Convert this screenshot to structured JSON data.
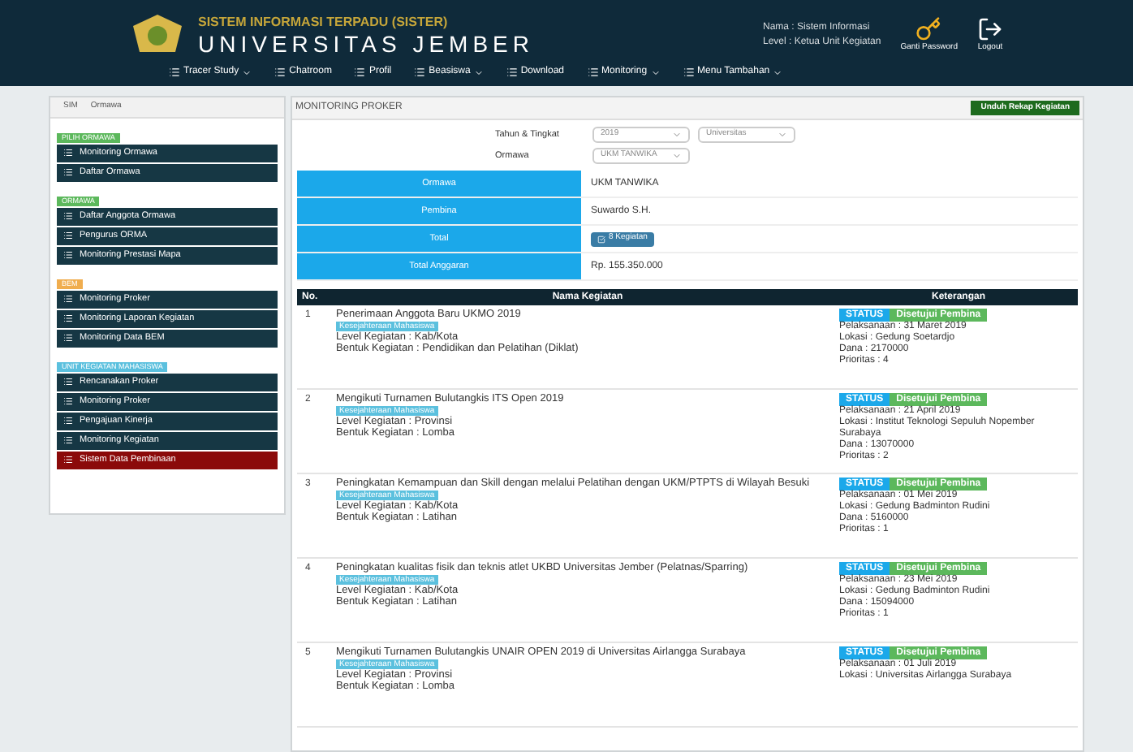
{
  "header": {
    "system": "SISTEM INFORMASI TERPADU (SISTER)",
    "university": "UNIVERSITAS JEMBER",
    "user_name": "Nama : Sistem Informasi",
    "user_level": "Level : Ketua Unit Kegiatan",
    "password_link": "Ganti Password",
    "logout_link": "Logout"
  },
  "nav": [
    {
      "label": "Tracer Study",
      "dropdown": true
    },
    {
      "label": "Chatroom",
      "dropdown": false
    },
    {
      "label": "Profil",
      "dropdown": false
    },
    {
      "label": "Beasiswa",
      "dropdown": true
    },
    {
      "label": "Download",
      "dropdown": false
    },
    {
      "label": "Monitoring",
      "dropdown": true
    },
    {
      "label": "Menu Tambahan",
      "dropdown": true
    }
  ],
  "breadcrumb": [
    "SIM",
    "Ormawa"
  ],
  "sidebar": [
    {
      "title": "PILIH ORMAWA",
      "color": "#5cb85c",
      "items": [
        {
          "label": "Monitoring Ormawa",
          "danger": false
        },
        {
          "label": "Daftar Ormawa",
          "danger": false
        }
      ]
    },
    {
      "title": "ORMAWA",
      "color": "#5cb85c",
      "items": [
        {
          "label": "Daftar Anggota Ormawa",
          "danger": false
        },
        {
          "label": "Pengurus ORMA",
          "danger": false
        },
        {
          "label": "Monitoring Prestasi Mapa",
          "danger": false
        }
      ]
    },
    {
      "title": "BEM",
      "color": "#f0ad4e",
      "items": [
        {
          "label": "Monitoring Proker",
          "danger": false
        },
        {
          "label": "Monitoring Laporan Kegiatan",
          "danger": false
        },
        {
          "label": "Monitoring Data BEM",
          "danger": false
        }
      ]
    },
    {
      "title": "UNIT KEGIATAN MAHASISWA",
      "color": "#5bc0de",
      "items": [
        {
          "label": "Rencanakan Proker",
          "danger": false
        },
        {
          "label": "Monitoring Proker",
          "danger": false
        },
        {
          "label": "Pengajuan Kinerja",
          "danger": false
        },
        {
          "label": "Monitoring Kegiatan",
          "danger": false
        },
        {
          "label": "Sistem Data Pembinaan",
          "danger": true
        }
      ]
    }
  ],
  "page_title": "MONITORING PROKER",
  "download_button": "Unduh Rekap Kegiatan",
  "filters": [
    {
      "label": "Tahun & Tingkat",
      "selects": [
        "2019",
        "Universitas"
      ]
    },
    {
      "label": "Ormawa",
      "selects": [
        "UKM TANWIKA"
      ]
    }
  ],
  "info": [
    {
      "label": "Ormawa",
      "kind": "text",
      "value": "UKM TANWIKA"
    },
    {
      "label": "Pembina",
      "kind": "text",
      "value": "Suwardo S.H."
    },
    {
      "label": "Total",
      "kind": "button",
      "value": "8 Kegiatan"
    },
    {
      "label": "Total Anggaran",
      "kind": "text",
      "value": "Rp. 155.350.000"
    }
  ],
  "table": {
    "columns": [
      "No.",
      "Nama Kegiatan",
      "Keterangan"
    ],
    "rows": [
      {
        "no": "1",
        "name": "Penerimaan Anggota Baru UKMO 2019",
        "tag": "Kesejahteraan Mahasiswa",
        "details": [
          "Level Kegiatan : Kab/Kota",
          "Bentuk Kegiatan : Pendidikan dan Pelatihan (Diklat)"
        ],
        "status": "STATUS",
        "status_value": "Disetujui Pembina",
        "notes": [
          "Pelaksanaan : 31 Maret 2019",
          "Lokasi : Gedung Soetardjo",
          "Dana : 2170000",
          "Prioritas : 4"
        ]
      },
      {
        "no": "2",
        "name": "Mengikuti Turnamen Bulutangkis ITS Open 2019",
        "tag": "Kesejahteraan Mahasiswa",
        "details": [
          "Level Kegiatan : Provinsi",
          "Bentuk Kegiatan : Lomba"
        ],
        "status": "STATUS",
        "status_value": "Disetujui Pembina",
        "notes": [
          "Pelaksanaan : 21 April 2019",
          "Lokasi : Institut Teknologi Sepuluh Nopember Surabaya",
          "Dana : 13070000",
          "Prioritas : 2"
        ]
      },
      {
        "no": "3",
        "name": "Peningkatan Kemampuan dan Skill dengan melalui Pelatihan dengan UKM/PTPTS di Wilayah Besuki",
        "tag": "Kesejahteraan Mahasiswa",
        "details": [
          "Level Kegiatan : Kab/Kota",
          "Bentuk Kegiatan : Latihan"
        ],
        "status": "STATUS",
        "status_value": "Disetujui Pembina",
        "notes": [
          "Pelaksanaan : 01 Mei 2019",
          "Lokasi : Gedung Badminton Rudini",
          "Dana : 5160000",
          "Prioritas : 1"
        ]
      },
      {
        "no": "4",
        "name": "Peningkatan kualitas fisik dan teknis atlet UKBD Universitas Jember (Pelatnas/Sparring)",
        "tag": "Kesejahteraan Mahasiswa",
        "details": [
          "Level Kegiatan : Kab/Kota",
          "Bentuk Kegiatan : Latihan"
        ],
        "status": "STATUS",
        "status_value": "Disetujui Pembina",
        "notes": [
          "Pelaksanaan : 23 Mei 2019",
          "Lokasi : Gedung Badminton Rudini",
          "Dana : 15094000",
          "Prioritas : 1"
        ]
      },
      {
        "no": "5",
        "name": "Mengikuti Turnamen Bulutangkis UNAIR OPEN 2019 di Universitas Airlangga Surabaya",
        "tag": "Kesejahteraan Mahasiswa",
        "details": [
          "Level Kegiatan : Provinsi",
          "Bentuk Kegiatan : Lomba"
        ],
        "status": "STATUS",
        "status_value": "Disetujui Pembina",
        "notes": [
          "Pelaksanaan : 01 Juli 2019",
          "Lokasi : Universitas Airlangga Surabaya"
        ]
      }
    ]
  }
}
